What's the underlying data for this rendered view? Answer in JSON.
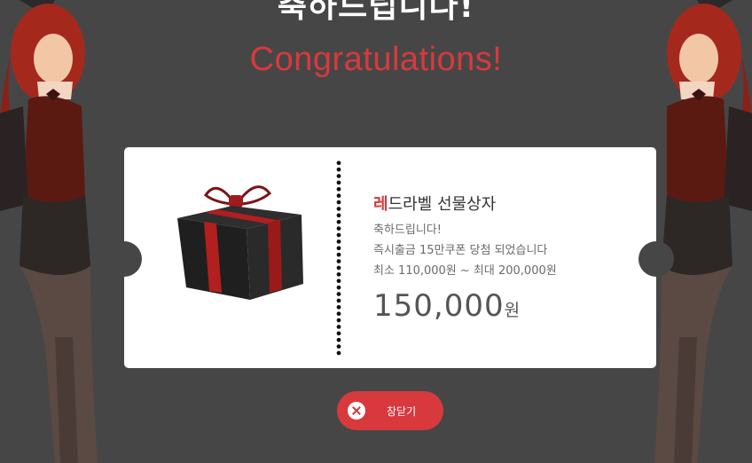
{
  "heading": {
    "korean": "축하드립니다!",
    "english": "Congratulations!"
  },
  "prize": {
    "title_accent": "레",
    "title_rest": "드라벨 선물상자",
    "line1": "축하드립니다!",
    "line2": "즉시출금 15만쿠폰 당첨 되었습니다",
    "line3": "최소 110,000원 ~ 최대 200,000원",
    "amount": "150,000",
    "unit": "원"
  },
  "close_button": {
    "label": "창닫기"
  },
  "colors": {
    "background": "#474646",
    "accent": "#d8393d",
    "card": "#ffffff"
  }
}
